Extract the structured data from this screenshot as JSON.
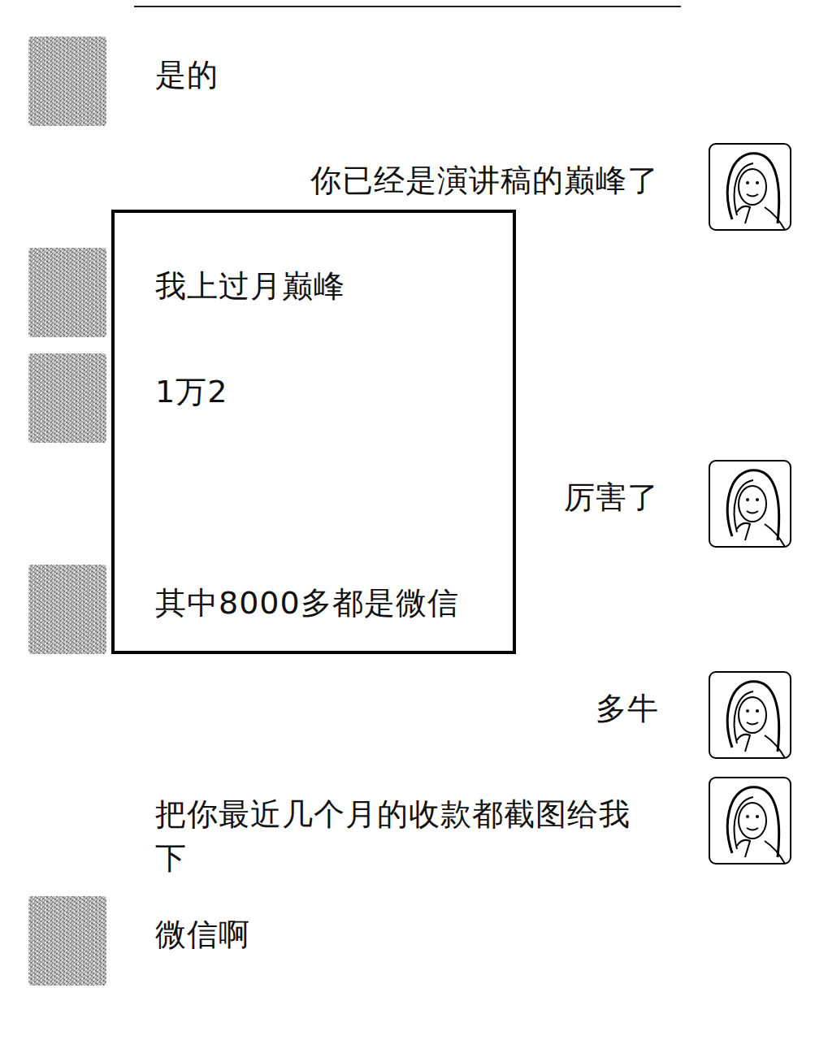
{
  "messages": [
    {
      "side": "left",
      "text": "是的",
      "highlighted": false
    },
    {
      "side": "right",
      "text": "你已经是演讲稿的巅峰了",
      "highlighted": false
    },
    {
      "side": "left",
      "text": "我上过月巅峰",
      "highlighted": true
    },
    {
      "side": "left",
      "text": "1万2",
      "highlighted": true
    },
    {
      "side": "right",
      "text": "厉害了",
      "highlighted": true
    },
    {
      "side": "left",
      "text": "其中8000多都是微信",
      "highlighted": true
    },
    {
      "side": "right",
      "text": "多牛",
      "highlighted": false
    },
    {
      "side": "right",
      "text": "把你最近几个月的收款都截图给我下",
      "highlighted": false
    },
    {
      "side": "left",
      "text": "微信啊",
      "highlighted": false
    }
  ]
}
